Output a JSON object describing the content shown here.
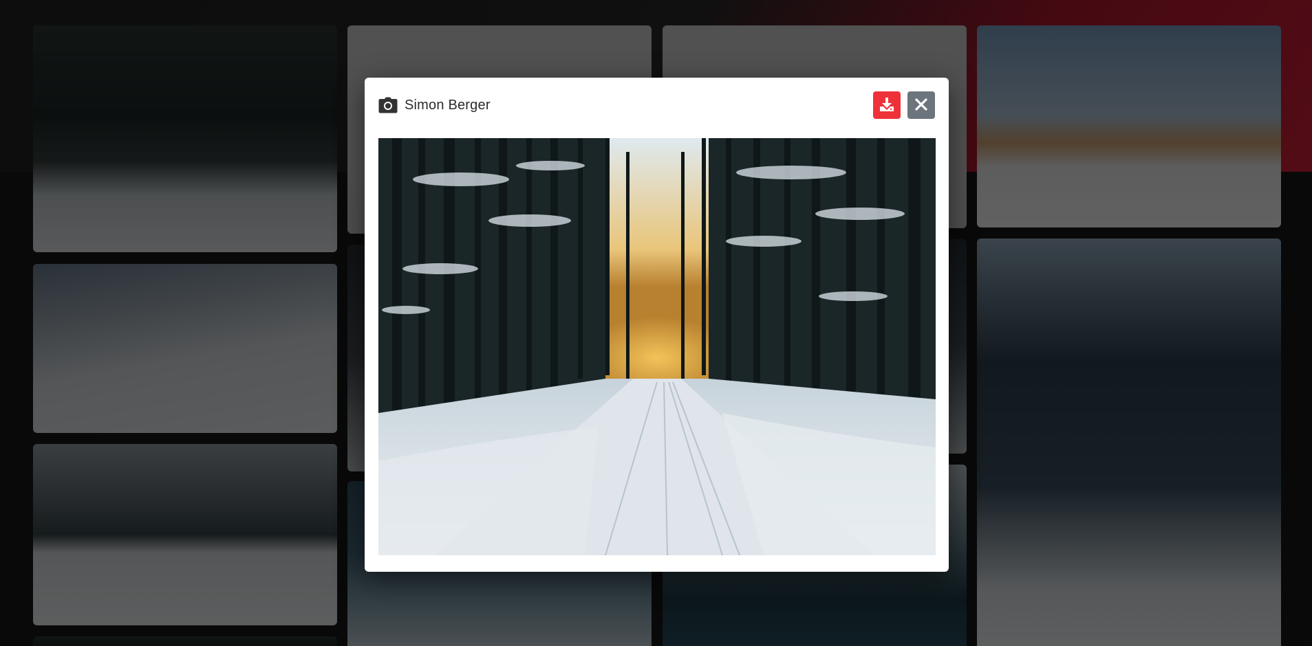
{
  "modal": {
    "photographer": "Simon Berger",
    "icons": {
      "camera": "camera-icon",
      "download": "download-icon",
      "close": "close-icon"
    },
    "image_subject": "snowy-forest-road"
  },
  "colors": {
    "download_button": "#ef3239",
    "close_button": "#6c757d",
    "modal_bg": "#ffffff",
    "accent_band": "#d8213a"
  },
  "gallery": {
    "tiles": [
      {
        "subject": "snowy-forest-road"
      },
      {
        "subject": "ski-touring-slope"
      },
      {
        "subject": "frozen-lake-valley"
      },
      {
        "subject": "forest-strip"
      },
      {
        "subject": "grey-placeholder"
      },
      {
        "subject": "dark-forest"
      },
      {
        "subject": "snowy-trees-aerial"
      },
      {
        "subject": "grey-placeholder"
      },
      {
        "subject": "snow-landscape"
      },
      {
        "subject": "frozen-ice-lake"
      },
      {
        "subject": "snowy-mountains"
      },
      {
        "subject": "pine-forest-road"
      }
    ]
  }
}
